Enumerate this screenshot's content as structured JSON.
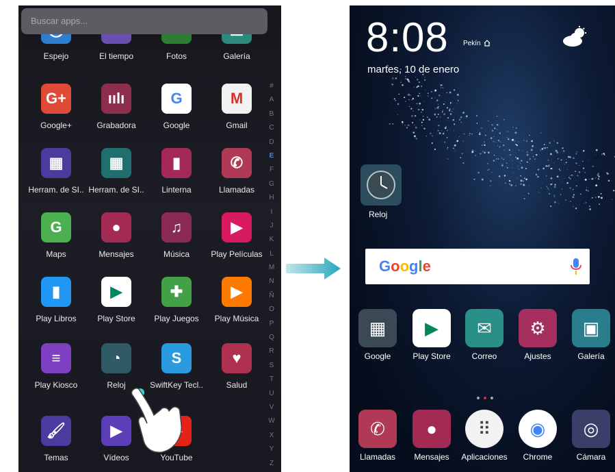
{
  "drawer": {
    "search_placeholder": "Buscar apps...",
    "alphabet": [
      "#",
      "A",
      "B",
      "C",
      "D",
      "E",
      "F",
      "G",
      "H",
      "I",
      "J",
      "K",
      "L",
      "M",
      "N",
      "Ñ",
      "O",
      "P",
      "Q",
      "R",
      "S",
      "T",
      "U",
      "V",
      "W",
      "X",
      "Y",
      "Z"
    ],
    "active_letter": "E",
    "apps": [
      {
        "label": "Espejo",
        "icon": "mirror-icon",
        "color": "#2f7fd0"
      },
      {
        "label": "El tiempo",
        "icon": "weather-icon",
        "color": "#6a4fb0"
      },
      {
        "label": "Fotos",
        "icon": "photos-icon",
        "color": "#2e7d32"
      },
      {
        "label": "Galería",
        "icon": "gallery-icon",
        "color": "#2a8a7e"
      },
      {
        "label": "Google+",
        "icon": "google-plus-icon",
        "color": "#e04a36"
      },
      {
        "label": "Grabadora",
        "icon": "recorder-icon",
        "color": "#8e2e4e"
      },
      {
        "label": "Google",
        "icon": "google-icon",
        "color": "#ffffff"
      },
      {
        "label": "Gmail",
        "icon": "gmail-icon",
        "color": "#f2f2f2"
      },
      {
        "label": "Herram. de SI..",
        "icon": "sim-toolkit-icon",
        "color": "#4a3c9e"
      },
      {
        "label": "Herram. de SI..",
        "icon": "sim-toolkit-icon",
        "color": "#1f6f6f"
      },
      {
        "label": "Linterna",
        "icon": "flashlight-icon",
        "color": "#a42858"
      },
      {
        "label": "Llamadas",
        "icon": "phone-icon",
        "color": "#b03a55"
      },
      {
        "label": "Maps",
        "icon": "maps-icon",
        "color": "#4caf50"
      },
      {
        "label": "Mensajes",
        "icon": "messages-icon",
        "color": "#a32a52"
      },
      {
        "label": "Música",
        "icon": "music-icon",
        "color": "#8b2a55"
      },
      {
        "label": "Play Películas",
        "icon": "play-movies-icon",
        "color": "#d81b60"
      },
      {
        "label": "Play Libros",
        "icon": "play-books-icon",
        "color": "#2196f3"
      },
      {
        "label": "Play Store",
        "icon": "play-store-icon",
        "color": "#ffffff"
      },
      {
        "label": "Play Juegos",
        "icon": "play-games-icon",
        "color": "#43a047"
      },
      {
        "label": "Play Música",
        "icon": "play-music-icon",
        "color": "#ff7a00"
      },
      {
        "label": "Play Kiosco",
        "icon": "play-newsstand-icon",
        "color": "#7e3fc2"
      },
      {
        "label": "Reloj",
        "icon": "clock-icon",
        "color": "#2f5a66"
      },
      {
        "label": "SwiftKey Tecl..",
        "icon": "swiftkey-icon",
        "color": "#2a9be0"
      },
      {
        "label": "Salud",
        "icon": "health-icon",
        "color": "#b0304f"
      },
      {
        "label": "Temas",
        "icon": "themes-icon",
        "color": "#4a3c9e"
      },
      {
        "label": "Vídeos",
        "icon": "videos-icon",
        "color": "#5a3fb8"
      },
      {
        "label": "YouTube",
        "icon": "youtube-icon",
        "color": "#e62117"
      }
    ]
  },
  "home": {
    "time": "8:08",
    "city": "Pekín",
    "date": "martes, 10 de enero",
    "widget_label": "Reloj",
    "search_brand": "Google",
    "dock_row1": [
      {
        "label": "Google",
        "icon": "google-folder-icon",
        "color": "#3a4a55"
      },
      {
        "label": "Play Store",
        "icon": "play-store-icon",
        "color": "#ffffff"
      },
      {
        "label": "Correo",
        "icon": "mail-icon",
        "color": "#2a8f86"
      },
      {
        "label": "Ajustes",
        "icon": "settings-icon",
        "color": "#a53060"
      },
      {
        "label": "Galería",
        "icon": "gallery-icon",
        "color": "#2a7d8a"
      }
    ],
    "dock_row2": [
      {
        "label": "Llamadas",
        "icon": "phone-icon",
        "color": "#b03a55"
      },
      {
        "label": "Mensajes",
        "icon": "messages-icon",
        "color": "#a32a52"
      },
      {
        "label": "Aplicaciones",
        "icon": "apps-grid-icon",
        "color": "#f2f2f2"
      },
      {
        "label": "Chrome",
        "icon": "chrome-icon",
        "color": "#ffffff"
      },
      {
        "label": "Cámara",
        "icon": "camera-icon",
        "color": "#3a3f6a"
      }
    ]
  },
  "colors": {
    "arrow": "#3ab0c0",
    "accent_letter": "#3d8de0"
  }
}
